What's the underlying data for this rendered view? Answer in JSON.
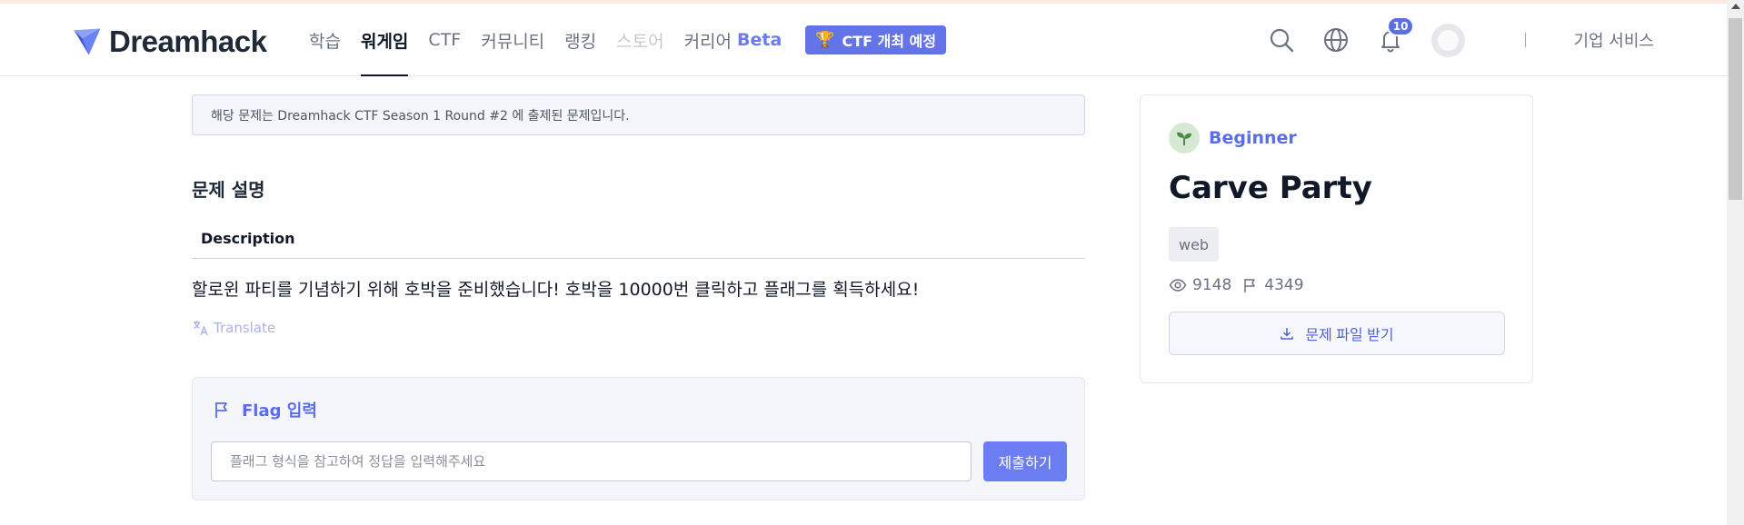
{
  "brand": {
    "logo_text": "Dreamhack",
    "accent": "#5b6ee8"
  },
  "nav": {
    "items": [
      {
        "label": "학습"
      },
      {
        "label": "워게임"
      },
      {
        "label": "CTF"
      },
      {
        "label": "커뮤니티"
      },
      {
        "label": "랭킹"
      },
      {
        "label": "스토어"
      },
      {
        "label": "커리어",
        "badge": "Beta"
      }
    ],
    "ctf_badge": "CTF 개최 예정"
  },
  "header": {
    "notification_count": "10",
    "business_link": "기업 서비스",
    "icons": [
      "search-icon",
      "globe-icon",
      "bell-icon",
      "avatar"
    ]
  },
  "notice": {
    "text": "해당 문제는 Dreamhack CTF Season 1 Round #2 에 출제된 문제입니다."
  },
  "problem": {
    "section_title": "문제 설명",
    "description_heading": "Description",
    "description_text": "할로윈 파티를 기념하기 위해 호박을 준비했습니다! 호박을 10000번 클릭하고 플래그를 획득하세요!",
    "translate_label": "Translate"
  },
  "flag": {
    "title": "Flag 입력",
    "placeholder": "플래그 형식을 참고하여 정답을 입력해주세요",
    "value": "",
    "submit_label": "제출하기"
  },
  "challenge": {
    "level": "Beginner",
    "title": "Carve Party",
    "tags": [
      "web"
    ],
    "views": "9148",
    "solves": "4349",
    "download_label": "문제 파일 받기"
  }
}
